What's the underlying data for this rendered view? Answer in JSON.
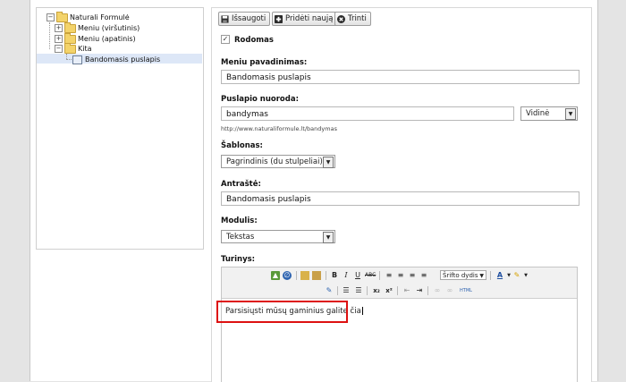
{
  "tree": {
    "root": "Naturali Formulė",
    "items": [
      {
        "label": "Meniu (viršutinis)",
        "toggle": "+"
      },
      {
        "label": "Meniu (apatinis)",
        "toggle": "+"
      },
      {
        "label": "Kita",
        "toggle": "−"
      }
    ],
    "selected": "Bandomasis puslapis"
  },
  "toolbar": {
    "save": "Išsaugoti",
    "add": "Pridėti naują",
    "delete": "Trinti"
  },
  "form": {
    "visible_label": "Rodomas",
    "visible_checked": "✓",
    "menu_name_label": "Meniu pavadinimas:",
    "menu_name_value": "Bandomasis puslapis",
    "link_label": "Puslapio nuoroda:",
    "link_value": "bandymas",
    "link_type": "Vidinė",
    "link_hint": "http://www.naturaliformule.lt/bandymas",
    "template_label": "Šablonas:",
    "template_value": "Pagrindinis (du stulpeliai)",
    "title_label": "Antraštė:",
    "title_value": "Bandomasis puslapis",
    "module_label": "Modulis:",
    "module_value": "Tekstas",
    "content_label": "Turinys:"
  },
  "editor": {
    "font_size_placeholder": "Šrifto dydis",
    "content": "Parsisiųsti mūsų gaminius galite čia"
  },
  "colors": {
    "highlight": "#dd1111",
    "selection": "#dde7f7"
  }
}
